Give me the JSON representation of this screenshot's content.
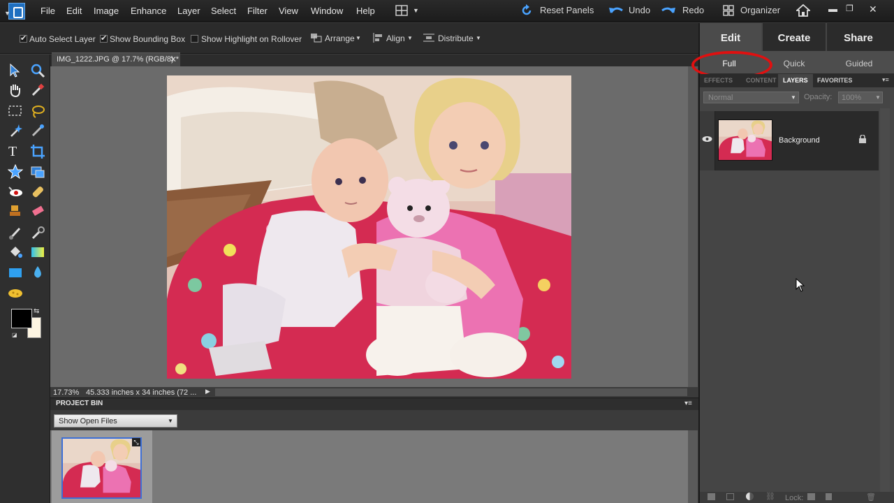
{
  "menubar": {
    "items": [
      "File",
      "Edit",
      "Image",
      "Enhance",
      "Layer",
      "Select",
      "Filter",
      "View",
      "Window",
      "Help"
    ],
    "reset_panels": "Reset Panels",
    "undo": "Undo",
    "redo": "Redo",
    "organizer": "Organizer"
  },
  "options": {
    "auto_select_layer": "Auto Select Layer",
    "show_bounding_box": "Show Bounding Box",
    "show_highlight": "Show Highlight on Rollover",
    "arrange": "Arrange",
    "align": "Align",
    "distribute": "Distribute",
    "auto_select_checked": true,
    "bounding_box_checked": true,
    "highlight_checked": false
  },
  "document": {
    "tab_title": "IMG_1222.JPG @ 17.7% (RGB/8) *",
    "zoom": "17.73%",
    "size_info": "45.333 inches x 34 inches (72 ..."
  },
  "project_bin": {
    "title": "PROJECT BIN",
    "select_value": "Show Open Files"
  },
  "panel": {
    "modes": [
      "Edit",
      "Create",
      "Share"
    ],
    "subtabs": [
      "Full",
      "Quick",
      "Guided"
    ],
    "palette_tabs": [
      "EFFECTS",
      "CONTENT",
      "LAYERS",
      "FAVORITES"
    ],
    "blend_mode": "Normal",
    "opacity_label": "Opacity:",
    "opacity_value": "100%",
    "layer_name": "Background",
    "lock_label": "Lock:"
  },
  "colors": {
    "foreground": "#000000",
    "background": "#fdf5e2",
    "highlight_ring": "#e01010"
  }
}
